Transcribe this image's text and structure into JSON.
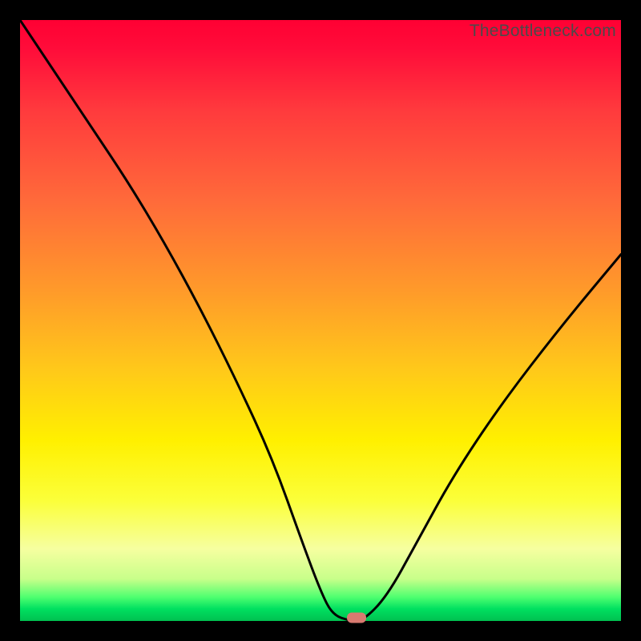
{
  "watermark": "TheBottleneck.com",
  "colors": {
    "frame": "#000000",
    "marker": "#d87a70",
    "curve": "#000000"
  },
  "chart_data": {
    "type": "line",
    "title": "",
    "xlabel": "",
    "ylabel": "",
    "xlim": [
      0,
      100
    ],
    "ylim": [
      0,
      100
    ],
    "grid": false,
    "series": [
      {
        "name": "bottleneck-curve",
        "x": [
          0,
          6,
          12,
          18,
          24,
          30,
          36,
          42,
          47,
          50,
          52,
          55,
          57,
          61,
          66,
          72,
          80,
          90,
          100
        ],
        "values": [
          100,
          91,
          82,
          73,
          63,
          52,
          40,
          27,
          13,
          5,
          1,
          0,
          0,
          4,
          13,
          24,
          36,
          49,
          61
        ]
      }
    ],
    "marker": {
      "x": 56,
      "y": 0.5
    }
  }
}
